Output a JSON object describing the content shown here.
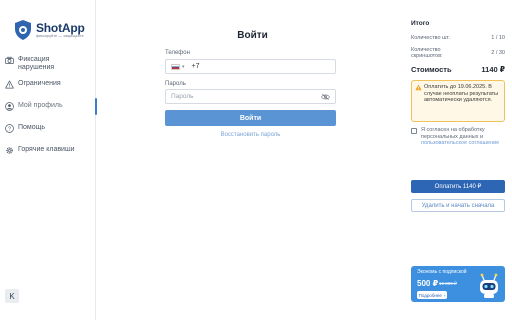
{
  "brand": {
    "name": "ShotApp",
    "tagline": "фиксируйте — защищайте"
  },
  "sidebar": {
    "items": [
      {
        "label": "Фиксация нарушения",
        "icon": "camera-icon"
      },
      {
        "label": "Ограничения",
        "icon": "warning-triangle-icon"
      },
      {
        "label": "Мой профиль",
        "icon": "user-icon",
        "active": true
      },
      {
        "label": "Помощь",
        "icon": "help-circle-icon"
      },
      {
        "label": "Горячие клавиши",
        "icon": "gear-icon"
      }
    ],
    "collapse_label": "K"
  },
  "login": {
    "title": "Войти",
    "phone_label": "Телефон",
    "phone_prefix": "+7",
    "password_label": "Пароль",
    "password_placeholder": "Пароль",
    "submit_label": "Войти",
    "restore_link": "Восстановить пароль"
  },
  "summary": {
    "title": "Итого",
    "rows": [
      {
        "label": "Количество шт.",
        "value": "1 / 10"
      },
      {
        "label": "Количество скриншотов:",
        "value": "2 / 30"
      }
    ],
    "total_label": "Стоимость",
    "total_value": "1140 ₽",
    "warning": "Оплатить до 19.06.2025. В случае неоплаты результаты автоматически удаляются.",
    "consent_text": "Я согласен на обработку персональных данных и",
    "consent_link": "пользовательское соглашение",
    "pay_label": "Оплатить 1140 ₽",
    "delete_label": "Удалить и начать сначала"
  },
  "promo": {
    "line1": "Экономь с подпиской",
    "price": "500 ₽",
    "old_price": "10 800 ₽",
    "button": "Подробнее"
  },
  "colors": {
    "accent": "#2d66b5",
    "button_light": "#5b94d4",
    "warning_bg": "#fff8e6",
    "warning_border": "#f0c35a",
    "promo_bg": "#3d8fe0"
  }
}
